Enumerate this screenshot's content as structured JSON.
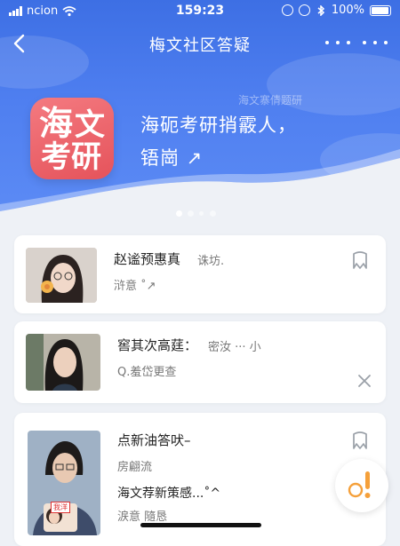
{
  "status_bar": {
    "carrier": "ncion",
    "time": "159:23",
    "battery": "100%"
  },
  "nav": {
    "title": "梅文社区答疑"
  },
  "banner": {
    "watermark": "海文寨倩题研",
    "logo_char_1": "海",
    "logo_char_2": "文",
    "logo_char_3": "考研",
    "line1": "海砈考研捎霰人，",
    "line2": "铻崗 ↗"
  },
  "cards": [
    {
      "name": "赵谧预惠真",
      "meta": "诛坊.",
      "sub": "浒意 ˚↗"
    },
    {
      "name": "窖其次高莛：",
      "meta": "密汝 ··· 小",
      "sub": "Q.羞岱更查"
    },
    {
      "name": "点新油答吠–",
      "meta": "房翩流",
      "detail": "海文荐新策感...˚^",
      "sub": "涙意  隨恳",
      "avatar_sign": "我洋"
    }
  ],
  "colors": {
    "header_blue": "#4a78ec",
    "logo_red": "#e85a61",
    "fab_orange": "#f5a03a"
  }
}
